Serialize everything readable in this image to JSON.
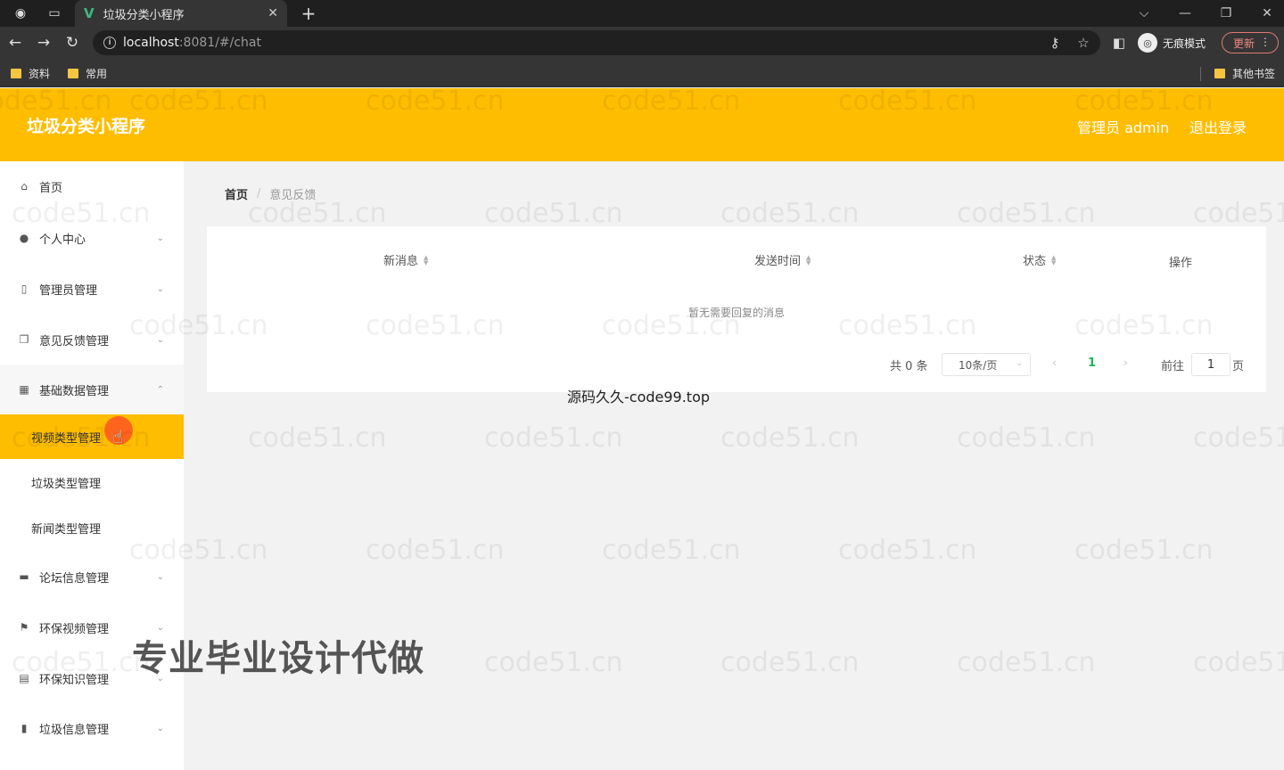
{
  "browser": {
    "tab_title": "垃圾分类小程序",
    "url_host": "localhost",
    "url_rest": ":8081/#/chat",
    "incognito_label": "无痕模式",
    "update_label": "更新",
    "bookmarks": [
      "资料",
      "常用"
    ],
    "other_bookmarks": "其他书签"
  },
  "header": {
    "title": "垃圾分类小程序",
    "user": "管理员 admin",
    "logout": "退出登录"
  },
  "sidebar": {
    "items": [
      {
        "label": "首页",
        "icon": "home-icon"
      },
      {
        "label": "个人中心",
        "icon": "user-icon"
      },
      {
        "label": "管理员管理",
        "icon": "phone-icon"
      },
      {
        "label": "意见反馈管理",
        "icon": "copy-icon"
      },
      {
        "label": "基础数据管理",
        "icon": "grid-icon"
      },
      {
        "label": "论坛信息管理",
        "icon": "monitor-icon"
      },
      {
        "label": "环保视频管理",
        "icon": "flag-icon"
      },
      {
        "label": "环保知识管理",
        "icon": "document-icon"
      },
      {
        "label": "垃圾信息管理",
        "icon": "bar-chart-icon"
      }
    ],
    "sub_items": [
      "视频类型管理",
      "垃圾类型管理",
      "新闻类型管理"
    ]
  },
  "breadcrumb": {
    "home": "首页",
    "current": "意见反馈"
  },
  "table": {
    "columns": [
      "新消息",
      "发送时间",
      "状态",
      "操作"
    ],
    "empty_text": "暂无需要回复的消息"
  },
  "pagination": {
    "total": "共 0 条",
    "page_size": "10条/页",
    "current_page": "1",
    "goto_label": "前往",
    "goto_value": "1",
    "page_unit": "页"
  },
  "overlay": {
    "source_caption": "源码久久-code99.top",
    "promo": "专业毕业设计代做",
    "watermark": "code51.cn"
  }
}
